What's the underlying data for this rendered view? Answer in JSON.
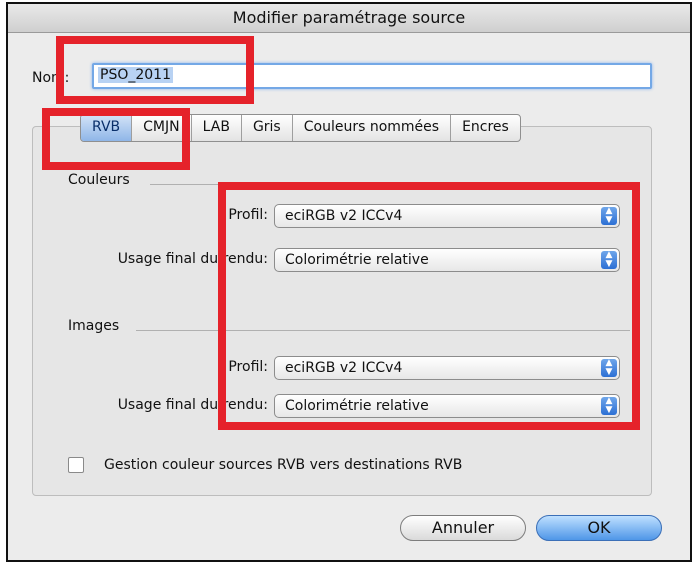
{
  "dialog": {
    "title": "Modifier paramétrage source"
  },
  "name": {
    "label": "Nom:",
    "value": "PSO_2011"
  },
  "tabs": [
    {
      "label": "RVB",
      "active": true
    },
    {
      "label": "CMJN",
      "active": false
    },
    {
      "label": "LAB",
      "active": false
    },
    {
      "label": "Gris",
      "active": false
    },
    {
      "label": "Couleurs nommées",
      "active": false
    },
    {
      "label": "Encres",
      "active": false
    }
  ],
  "couleurs": {
    "header": "Couleurs",
    "profile_label": "Profil:",
    "profile_value": "eciRGB v2 ICCv4",
    "intent_label": "Usage final du rendu:",
    "intent_value": "Colorimétrie relative"
  },
  "images": {
    "header": "Images",
    "profile_label": "Profil:",
    "profile_value": "eciRGB v2 ICCv4",
    "intent_label": "Usage final du rendu:",
    "intent_value": "Colorimétrie relative"
  },
  "gestion": {
    "label": "Gestion couleur sources RVB vers destinations RVB",
    "checked": false
  },
  "buttons": {
    "cancel": "Annuler",
    "ok": "OK"
  },
  "colors": {
    "highlight_red": "#e5222a",
    "accent_blue": "#4f96e8"
  }
}
